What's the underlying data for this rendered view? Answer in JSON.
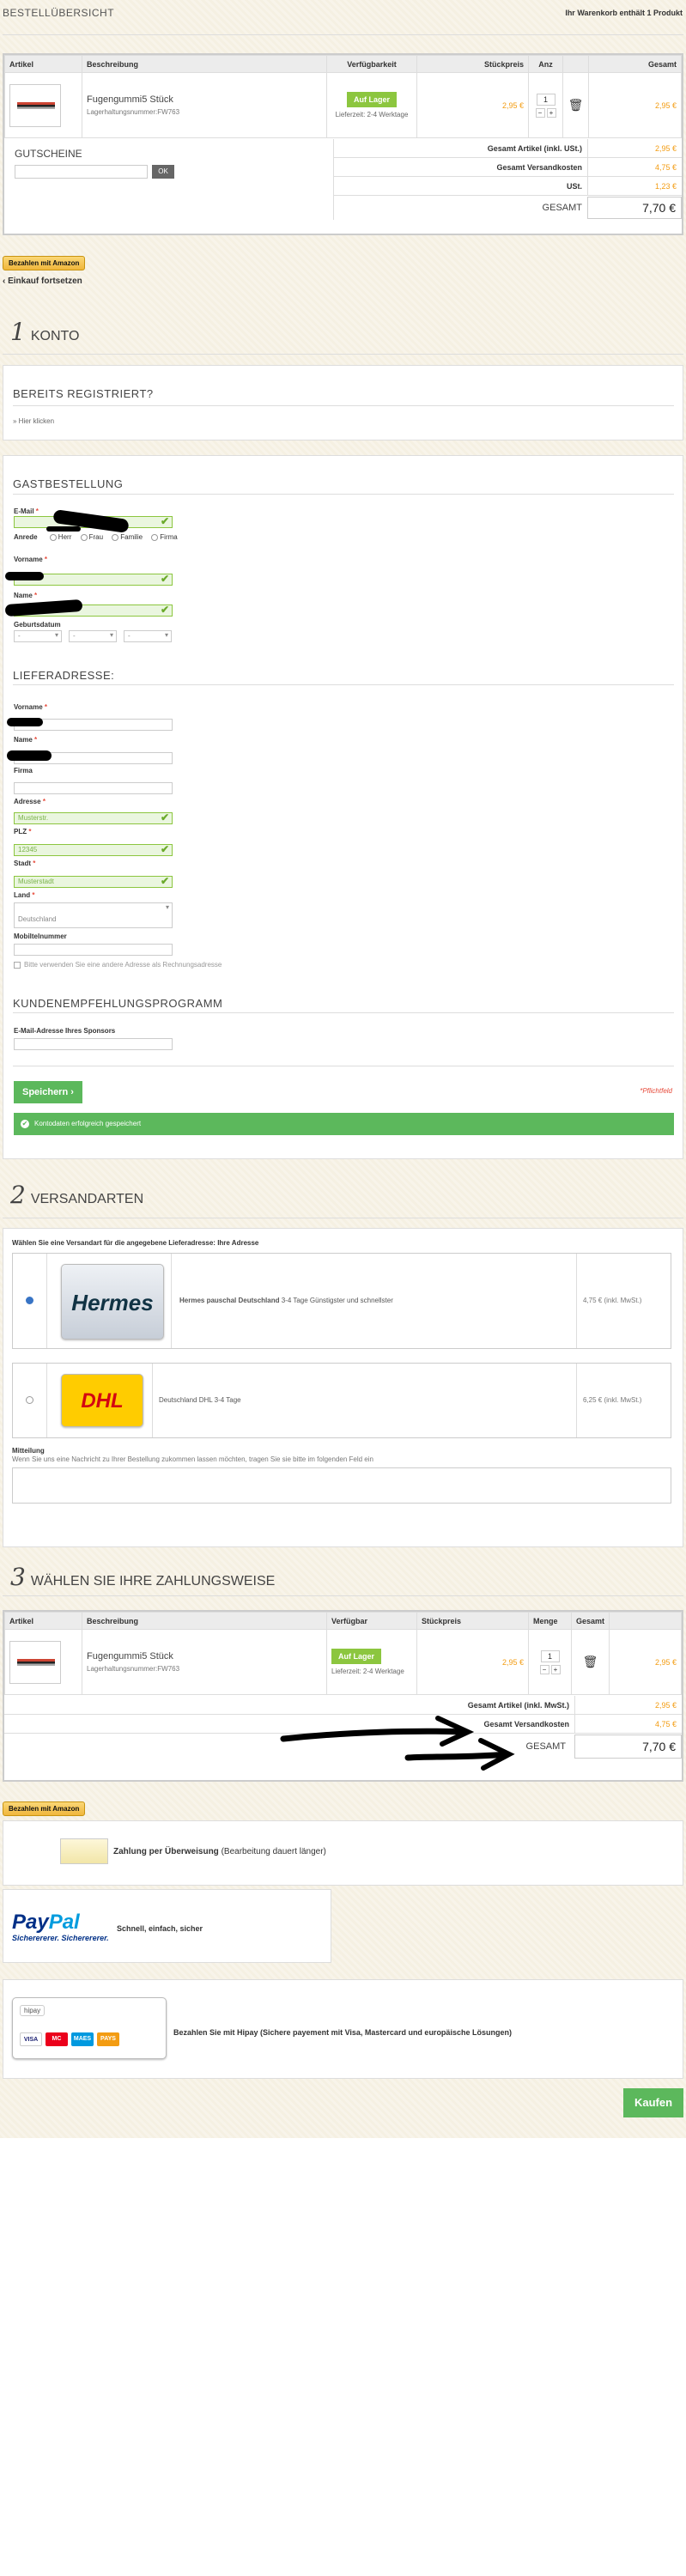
{
  "header": {
    "title": "BESTELLÜBERSICHT",
    "cart_info": "Ihr Warenkorb enthält 1 Produkt"
  },
  "cart": {
    "columns": [
      "Artikel",
      "Beschreibung",
      "Verfügbarkeit",
      "Stückpreis",
      "Anz",
      "Gesamt"
    ],
    "item": {
      "name": "Fugengummi5 Stück",
      "sku": "Lagerhaltungsnummer:FW763",
      "stock": "Auf Lager",
      "delivery": "Lieferzeit: 2-4 Werktage",
      "unit_price": "2,95 €",
      "qty": "1",
      "total": "2,95 €",
      "minus": "−",
      "plus": "+"
    },
    "coupon": {
      "title": "GUTSCHEINE",
      "ok": "OK"
    },
    "totals": [
      {
        "label": "Gesamt Artikel (inkl. USt.)",
        "value": "2,95 €"
      },
      {
        "label": "Gesamt Versandkosten",
        "value": "4,75 €"
      },
      {
        "label": "USt.",
        "value": "1,23 €"
      }
    ],
    "grand": {
      "label": "GESAMT",
      "value": "7,70 €"
    }
  },
  "amazon": {
    "label": "Bezahlen mit Amazon"
  },
  "continue": {
    "label": "Einkauf fortsetzen"
  },
  "step1": {
    "num": "1",
    "title": "KONTO"
  },
  "registered": {
    "title": "BEREITS REGISTRIERT?",
    "link": "» Hier klicken"
  },
  "guest": {
    "title": "GASTBESTELLUNG",
    "email_label": "E-Mail",
    "salutation_label": "Anrede",
    "salutations": [
      "Herr",
      "Frau",
      "Familie",
      "Firma"
    ],
    "firstname_label": "Vorname",
    "name_label": "Name",
    "birthday_label": "Geburtsdatum",
    "dash": "-"
  },
  "delivery": {
    "title": "LIEFERADRESSE:",
    "firstname_label": "Vorname",
    "name_label": "Name",
    "company_label": "Firma",
    "address_label": "Adresse",
    "address_value": "Musterstr.",
    "zip_label": "PLZ",
    "zip_value": "12345",
    "city_label": "Stadt",
    "city_value": "Musterstadt",
    "country_label": "Land",
    "country_value": "Deutschland",
    "mobile_label": "Mobiltelnummer",
    "billing_checkbox": "Bitte verwenden Sie eine andere Adresse als Rechnungsadresse"
  },
  "referral": {
    "title": "KUNDENEMPFEHLUNGSPROGRAMM",
    "sponsor_label": "E-Mail-Adresse Ihres Sponsors"
  },
  "save": {
    "button": "Speichern",
    "required_note": "*Pflichtfeld",
    "success": "Kontodaten erfolgreich gespeichert"
  },
  "step2": {
    "num": "2",
    "title": "VERSANDARTEN"
  },
  "shipping": {
    "intro": "Wählen Sie eine Versandart für die angegebene Lieferadresse: Ihre Adresse",
    "options": [
      {
        "logo": "Hermes",
        "name": "Hermes pauschal Deutschland",
        "desc": " 3-4 Tage Günstigster und schnellster",
        "price": "4,75 € (inkl. MwSt.)"
      },
      {
        "logo": "DHL",
        "name": "Deutschland DHL",
        "desc": " 3-4 Tage",
        "price": "6,25 € (inkl. MwSt.)"
      }
    ],
    "note_label": "Mitteilung",
    "note_hint": "Wenn Sie uns eine Nachricht zu Ihrer Bestellung zukommen lassen möchten, tragen Sie sie bitte im folgenden Feld ein"
  },
  "step3": {
    "num": "3",
    "title": "WÄHLEN SIE IHRE ZAHLUNGSWEISE"
  },
  "cart2": {
    "columns": [
      "Artikel",
      "Beschreibung",
      "Verfügbar",
      "Stückpreis",
      "Menge",
      "Gesamt"
    ],
    "totals": [
      {
        "label": "Gesamt Artikel (inkl. MwSt.)",
        "value": "2,95 €"
      },
      {
        "label": "Gesamt Versandkosten",
        "value": "4,75 €"
      }
    ],
    "grand": {
      "label": "GESAMT",
      "value": "7,70 €"
    }
  },
  "payments": {
    "transfer": {
      "title": "Zahlung per Überweisung",
      "desc": " (Bearbeitung dauert länger)"
    },
    "paypal": {
      "logo1": "Pay",
      "logo2": "Pal",
      "tagline": "Sicherererer. Sicherererer.",
      "desc": "Schnell, einfach, sicher"
    },
    "hipay": {
      "logo": "hipay",
      "desc": "Bezahlen Sie mit Hipay (Sichere payement mit Visa, Mastercard und europäische Lösungen)",
      "cards": [
        "VISA",
        "MC",
        "MAES",
        "PAYS"
      ]
    }
  },
  "buy": {
    "label": "Kaufen"
  }
}
